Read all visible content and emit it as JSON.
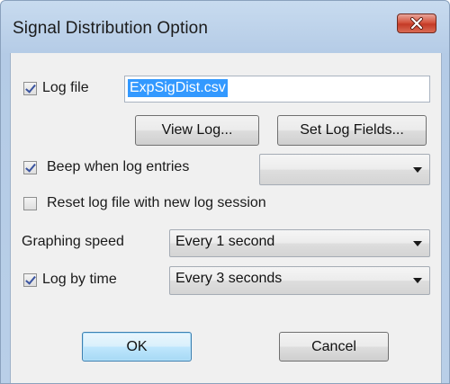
{
  "window": {
    "title": "Signal Distribution Option"
  },
  "log_file": {
    "label": "Log file",
    "checked": true,
    "value": "ExpSigDist.csv"
  },
  "buttons": {
    "view_log": "View Log...",
    "set_log_fields": "Set Log Fields...",
    "ok": "OK",
    "cancel": "Cancel"
  },
  "beep": {
    "label": "Beep when log entries",
    "checked": true,
    "value": ""
  },
  "reset": {
    "label": "Reset log file with new log session",
    "checked": false
  },
  "graphing_speed": {
    "label": "Graphing speed",
    "value": "Every 1 second"
  },
  "log_by_time": {
    "label": "Log by time",
    "checked": true,
    "value": "Every 3 seconds"
  },
  "icons": {
    "close": "close-icon",
    "dropdown": "chevron-down-icon"
  },
  "colors": {
    "selection": "#3399ff",
    "close_button": "#c43a26",
    "title_bar": "#b9cfe8"
  }
}
